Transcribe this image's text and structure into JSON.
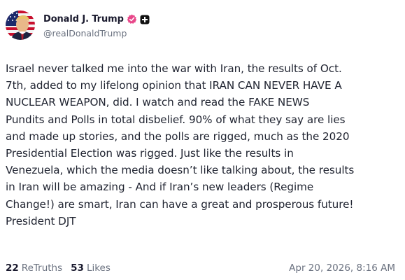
{
  "author": {
    "display_name": "Donald J. Trump",
    "handle": "@realDonaldTrump",
    "avatar_icon": "flag-portrait-avatar",
    "verified_icon": "verified-badge-icon",
    "verified_color": "#e8488a",
    "extra_badge_icon": "plus-badge-icon"
  },
  "post": {
    "text": "Israel never talked me into the war with Iran, the results of Oct.\n7th, added to my lifelong opinion that IRAN CAN NEVER HAVE A\nNUCLEAR WEAPON, did. I watch and read the FAKE NEWS\nPundits and Polls in total disbelief. 90% of what they say are lies\nand made up stories, and the polls are rigged, much as the 2020\nPresidential Election was rigged. Just like the results in\nVenezuela, which the media doesn’t like talking about, the results\nin Iran will be amazing - And if Iran’s new leaders (Regime\nChange!) are smart, Iran can have a great and prosperous future!\nPresident DJT"
  },
  "stats": {
    "retruths_count": "22",
    "retruths_label": "ReTruths",
    "likes_count": "53",
    "likes_label": "Likes"
  },
  "timestamp": "Apr 20, 2026, 8:16 AM",
  "colors": {
    "text": "#1f2330",
    "muted": "#6b7280",
    "name": "#1a1a2e"
  }
}
